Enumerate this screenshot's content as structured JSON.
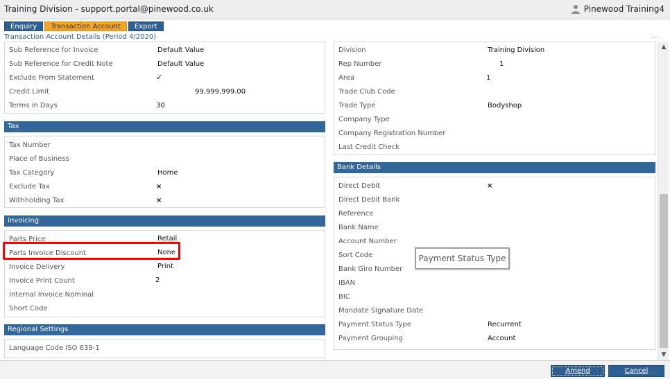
{
  "window": {
    "title": "Training Division - support.portal@pinewood.co.uk",
    "user": "Pinewood Training4"
  },
  "tabs": [
    {
      "label": "Enquiry"
    },
    {
      "label": "Transaction Account"
    },
    {
      "label": "Export"
    }
  ],
  "subtitle": "Transaction Account Details (Period 4/2020)",
  "left_top": [
    {
      "label": "Sub Reference for Invoice",
      "value": "Default Value"
    },
    {
      "label": "Sub Reference for Credit Note",
      "value": "Default Value"
    },
    {
      "label": "Exclude From Statement",
      "value": "✓"
    },
    {
      "label": "Credit Limit",
      "value": "99,999,999.00"
    },
    {
      "label": "Terms in Days",
      "value": "30"
    }
  ],
  "tax": {
    "header": "Tax",
    "rows": [
      {
        "label": "Tax Number",
        "value": ""
      },
      {
        "label": "Place of Business",
        "value": ""
      },
      {
        "label": "Tax Category",
        "value": "Home"
      },
      {
        "label": "Exclude Tax",
        "value": "×"
      },
      {
        "label": "Withholding Tax",
        "value": "×"
      }
    ]
  },
  "invoicing": {
    "header": "Invoicing",
    "rows": [
      {
        "label": "Parts Price",
        "value": "Retail"
      },
      {
        "label": "Parts Invoice Discount",
        "value": "None"
      },
      {
        "label": "Invoice Delivery",
        "value": "Print"
      },
      {
        "label": "Invoice Print Count",
        "value": "2"
      },
      {
        "label": "Internal Invoice Nominal",
        "value": ""
      },
      {
        "label": "Short Code",
        "value": ""
      }
    ]
  },
  "regional": {
    "header": "Regional Settings",
    "rows": [
      {
        "label": "Language Code ISO 639-1",
        "value": ""
      }
    ]
  },
  "right_top": [
    {
      "label": "Division",
      "value": "Training Division"
    },
    {
      "label": "Rep Number",
      "value": "1"
    },
    {
      "label": "Area",
      "value": "1"
    },
    {
      "label": "Trade Club Code",
      "value": ""
    },
    {
      "label": "Trade Type",
      "value": "Bodyshop"
    },
    {
      "label": "Company Type",
      "value": ""
    },
    {
      "label": "Company Registration Number",
      "value": ""
    },
    {
      "label": "Last Credit Check",
      "value": ""
    }
  ],
  "bank": {
    "header": "Bank Details",
    "rows": [
      {
        "label": "Direct Debit",
        "value": "×"
      },
      {
        "label": "Direct Debit Bank",
        "value": ""
      },
      {
        "label": "Reference",
        "value": ""
      },
      {
        "label": "Bank Name",
        "value": ""
      },
      {
        "label": "Account Number",
        "value": ""
      },
      {
        "label": "Sort Code",
        "value": ""
      },
      {
        "label": "Bank Giro Number",
        "value": ""
      },
      {
        "label": "IBAN",
        "value": ""
      },
      {
        "label": "BIC",
        "value": ""
      },
      {
        "label": "Mandate Signature Date",
        "value": ""
      },
      {
        "label": "Payment Status Type",
        "value": "Recurrent"
      },
      {
        "label": "Payment Grouping",
        "value": "Account"
      }
    ]
  },
  "tooltip": "Payment Status Type",
  "ellipsis": "...",
  "footer": {
    "amend_label": "Amend",
    "cancel_label": "Cancel"
  },
  "icons": {
    "user": "user-icon",
    "scroll_up": "scroll-up-icon",
    "scroll_down": "scroll-down-icon"
  },
  "colors": {
    "header_blue": "#336699",
    "tab_active": "#f5a623",
    "highlight": "#ff0000",
    "tick": "#4caf50",
    "cross": "#e53935"
  }
}
